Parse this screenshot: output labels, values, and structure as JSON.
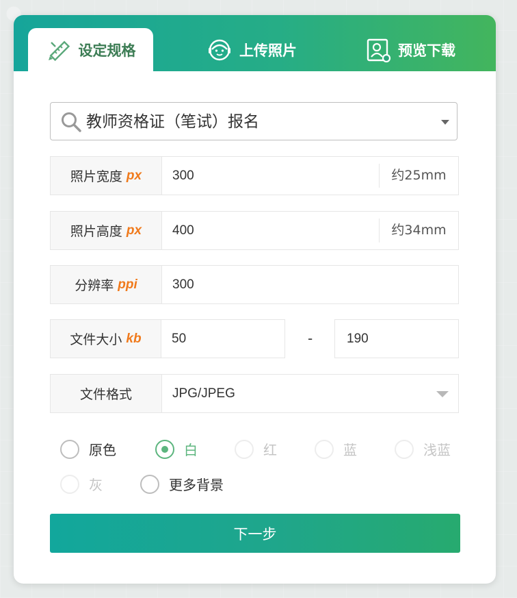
{
  "tabs": [
    {
      "label": "设定规格",
      "icon": "ruler-pencil-icon",
      "active": true
    },
    {
      "label": "上传照片",
      "icon": "user-face-icon",
      "active": false
    },
    {
      "label": "预览下载",
      "icon": "portrait-download-icon",
      "active": false
    }
  ],
  "spec_select": {
    "value": "教师资格证（笔试）报名",
    "icon": "search-icon"
  },
  "width_row": {
    "label": "照片宽度",
    "unit": "px",
    "value": "300",
    "suffix": "约25mm"
  },
  "height_row": {
    "label": "照片高度",
    "unit": "px",
    "value": "400",
    "suffix": "约34mm"
  },
  "resolution_row": {
    "label": "分辨率",
    "unit": "ppi",
    "value": "300"
  },
  "filesize_row": {
    "label": "文件大小",
    "unit": "kb",
    "min": "50",
    "separator": "-",
    "max": "190"
  },
  "format_row": {
    "label": "文件格式",
    "value": "JPG/JPEG"
  },
  "backgrounds": [
    {
      "label": "原色",
      "state": "normal"
    },
    {
      "label": "白",
      "state": "checked"
    },
    {
      "label": "红",
      "state": "disabled"
    },
    {
      "label": "蓝",
      "state": "disabled"
    },
    {
      "label": "浅蓝",
      "state": "disabled"
    },
    {
      "label": "灰",
      "state": "disabled"
    },
    {
      "label": "更多背景",
      "state": "normal"
    }
  ],
  "colors": {
    "accent_green": "#5cb57e",
    "unit_orange": "#f07a1c",
    "tab_gradient_start": "#16a59a",
    "tab_gradient_end": "#43b55d"
  },
  "next_button": {
    "label": "下一步"
  }
}
